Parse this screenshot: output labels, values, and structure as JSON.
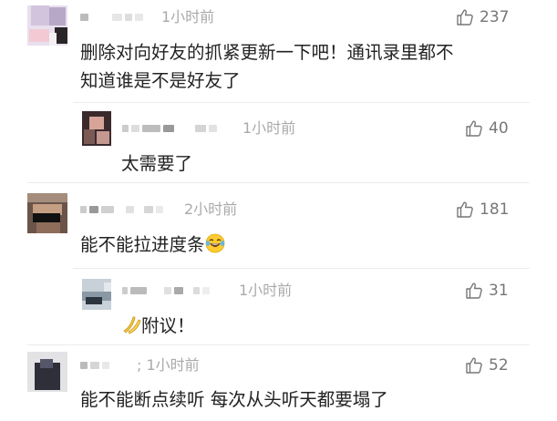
{
  "comments": [
    {
      "time": "1小时前",
      "likes": "237",
      "text_line1": "删除对向好友的抓紧更新一下吧！通讯录里都不",
      "text_line2": "知道谁是不是好友了",
      "replies": [
        {
          "time": "1小时前",
          "likes": "40",
          "text": "太需要了"
        }
      ]
    },
    {
      "time": "2小时前",
      "likes": "181",
      "text": "能不能拉进度条",
      "emoji": "laughing-tears-emoji",
      "replies": [
        {
          "time": "1小时前",
          "likes": "31",
          "emoji": "banana-emoji",
          "text": "附议！"
        }
      ]
    },
    {
      "time": "1小时前",
      "time_prefix": "; ",
      "likes": "52",
      "text": "能不能断点续听 每次从头听天都要塌了"
    }
  ],
  "icons": {
    "like": "thumbs-up-icon"
  }
}
